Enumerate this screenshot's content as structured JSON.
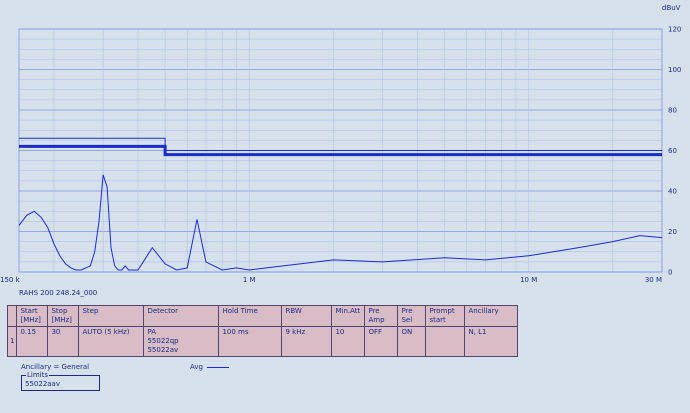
{
  "chart_data": {
    "type": "line",
    "y_unit": "dBuV",
    "y_ticks": [
      "120",
      "100",
      "80",
      "60",
      "40",
      "20",
      "0"
    ],
    "ylim": [
      0,
      120
    ],
    "x_scale": "log",
    "x_ticks": [
      "150 k",
      "1 M",
      "10 M",
      "30 M"
    ],
    "xlim_mhz": [
      0.15,
      30
    ],
    "grid": true,
    "series": [
      {
        "name": "Avg",
        "color": "#1d2ad8",
        "x_mhz": [
          0.15,
          0.16,
          0.17,
          0.18,
          0.19,
          0.2,
          0.21,
          0.22,
          0.23,
          0.24,
          0.25,
          0.26,
          0.27,
          0.28,
          0.29,
          0.3,
          0.31,
          0.32,
          0.33,
          0.34,
          0.35,
          0.36,
          0.37,
          0.38,
          0.4,
          0.45,
          0.5,
          0.55,
          0.6,
          0.65,
          0.7,
          0.8,
          0.9,
          1,
          2,
          3,
          5,
          7,
          10,
          15,
          20,
          25,
          30
        ],
        "y": [
          23,
          28,
          30,
          27,
          22,
          14,
          8,
          4,
          2,
          1,
          1,
          2,
          3,
          10,
          25,
          48,
          42,
          12,
          3,
          1,
          1,
          3,
          1,
          1,
          1,
          12,
          4,
          1,
          2,
          26,
          5,
          1,
          2,
          1,
          6,
          5,
          7,
          6,
          8,
          12,
          15,
          18,
          17
        ]
      },
      {
        "name": "55022qp",
        "color": "#1b2ccc",
        "x_mhz": [
          0.15,
          0.5,
          0.5,
          30
        ],
        "y": [
          66,
          66,
          60,
          60
        ]
      },
      {
        "name": "55022av",
        "color": "#1b2ccc",
        "x_mhz": [
          0.15,
          0.5,
          0.5,
          30
        ],
        "y": [
          62,
          62,
          58,
          58
        ]
      }
    ]
  },
  "trace_id": "RAHS 200 248.24_000",
  "settings_table": {
    "headers": [
      "Start [MHz]",
      "Stop [MHz]",
      "Step",
      "Detector",
      "Hold Time",
      "RBW",
      "Min.Att",
      "Pre Amp",
      "Pre Sel",
      "Prompt start",
      "Ancillary"
    ],
    "row_index": "1",
    "row": {
      "start": "0.15",
      "stop": "30",
      "step": "AUTO (5 kHz)",
      "detector": "PA\n55022qp\n55022av",
      "hold_time": "100 ms",
      "rbw": "9 kHz",
      "min_att": "10",
      "pre_amp": "OFF",
      "pre_sel": "ON",
      "prompt_start": "",
      "ancillary": "N, L1"
    }
  },
  "footer": {
    "ancillary_label": "Ancillary = General",
    "avg_legend_label": "Avg",
    "limits_title": "Limits",
    "limits_value": "55022aav"
  }
}
